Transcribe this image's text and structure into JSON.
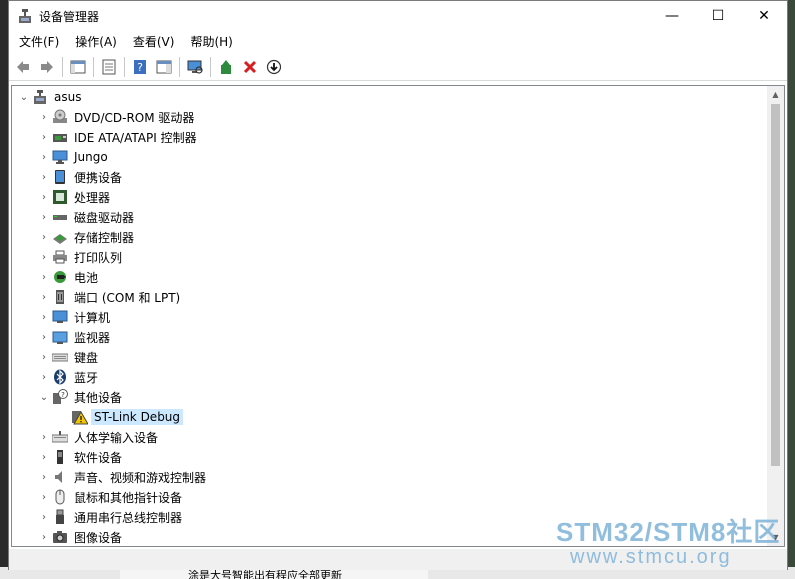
{
  "window": {
    "title": "设备管理器",
    "controls": {
      "minimize": "—",
      "maximize": "☐",
      "close": "✕"
    }
  },
  "menu": [
    "文件(F)",
    "操作(A)",
    "查看(V)",
    "帮助(H)"
  ],
  "toolbar": [
    "back-icon",
    "forward-icon",
    "show-hide-console-tree-icon",
    "properties-icon",
    "help-icon",
    "action-pane-icon",
    "scan-hardware-icon",
    "update-driver-icon",
    "uninstall-icon",
    "disable-icon"
  ],
  "tree": {
    "root": "asus",
    "items": [
      {
        "label": "DVD/CD-ROM 驱动器",
        "icon": "dvd-drive-icon",
        "expanded": false
      },
      {
        "label": "IDE ATA/ATAPI 控制器",
        "icon": "ide-controller-icon",
        "expanded": false
      },
      {
        "label": "Jungo",
        "icon": "jungo-device-icon",
        "expanded": false
      },
      {
        "label": "便携设备",
        "icon": "portable-device-icon",
        "expanded": false
      },
      {
        "label": "处理器",
        "icon": "processor-icon",
        "expanded": false
      },
      {
        "label": "磁盘驱动器",
        "icon": "disk-drive-icon",
        "expanded": false
      },
      {
        "label": "存储控制器",
        "icon": "storage-controller-icon",
        "expanded": false
      },
      {
        "label": "打印队列",
        "icon": "print-queue-icon",
        "expanded": false
      },
      {
        "label": "电池",
        "icon": "battery-icon",
        "expanded": false
      },
      {
        "label": "端口 (COM 和 LPT)",
        "icon": "port-icon",
        "expanded": false
      },
      {
        "label": "计算机",
        "icon": "computer-icon",
        "expanded": false
      },
      {
        "label": "监视器",
        "icon": "monitor-icon",
        "expanded": false
      },
      {
        "label": "键盘",
        "icon": "keyboard-icon",
        "expanded": false
      },
      {
        "label": "蓝牙",
        "icon": "bluetooth-icon",
        "expanded": false
      },
      {
        "label": "其他设备",
        "icon": "other-devices-icon",
        "expanded": true,
        "children": [
          {
            "label": "ST-Link Debug",
            "icon": "warning-device-icon",
            "selected": true
          }
        ]
      },
      {
        "label": "人体学输入设备",
        "icon": "hid-icon",
        "expanded": false
      },
      {
        "label": "软件设备",
        "icon": "software-device-icon",
        "expanded": false
      },
      {
        "label": "声音、视频和游戏控制器",
        "icon": "sound-icon",
        "expanded": false
      },
      {
        "label": "鼠标和其他指针设备",
        "icon": "mouse-icon",
        "expanded": false
      },
      {
        "label": "通用串行总线控制器",
        "icon": "usb-icon",
        "expanded": false
      },
      {
        "label": "图像设备",
        "icon": "imaging-device-icon",
        "expanded": false
      }
    ]
  },
  "watermark": {
    "line1": "STM32/STM8社区",
    "line2": "www.stmcu.org"
  },
  "background_text": "涂是大号智能出有程应全部更新",
  "colors": {
    "selection": "#cce8ff",
    "watermark": "#7fb3d9"
  }
}
